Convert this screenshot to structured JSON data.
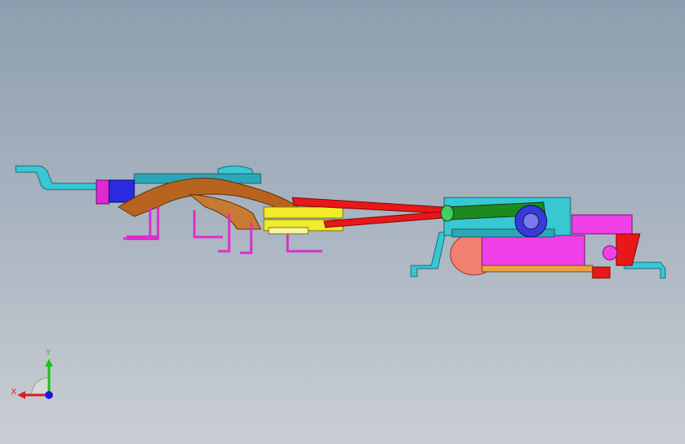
{
  "viewport": {
    "background_top": "#8e9eb0",
    "background_bottom": "#c9ced4"
  },
  "model": {
    "parts": [
      {
        "name": "left-mounting-bracket",
        "color": "#37c8d4"
      },
      {
        "name": "blue-clip-block",
        "color": "#2a2ae0"
      },
      {
        "name": "magenta-stand-legs",
        "color": "#e02ad0"
      },
      {
        "name": "brown-curved-arm",
        "color": "#b8641e"
      },
      {
        "name": "yellow-connector-block",
        "color": "#f2ec2a"
      },
      {
        "name": "red-rod",
        "color": "#e81818"
      },
      {
        "name": "green-shaft",
        "color": "#1e8a1e"
      },
      {
        "name": "cyan-motor-housing",
        "color": "#37c8d4"
      },
      {
        "name": "blue-gear",
        "color": "#3a3ad8"
      },
      {
        "name": "magenta-gear-body",
        "color": "#f040e8"
      },
      {
        "name": "salmon-drum",
        "color": "#f08070"
      },
      {
        "name": "right-mounting-bracket",
        "color": "#37c8d4"
      }
    ]
  },
  "triad": {
    "x_label": "X",
    "y_label": "Y",
    "x_color": "#e01818",
    "y_color": "#18c018",
    "z_color": "#1818e0"
  }
}
